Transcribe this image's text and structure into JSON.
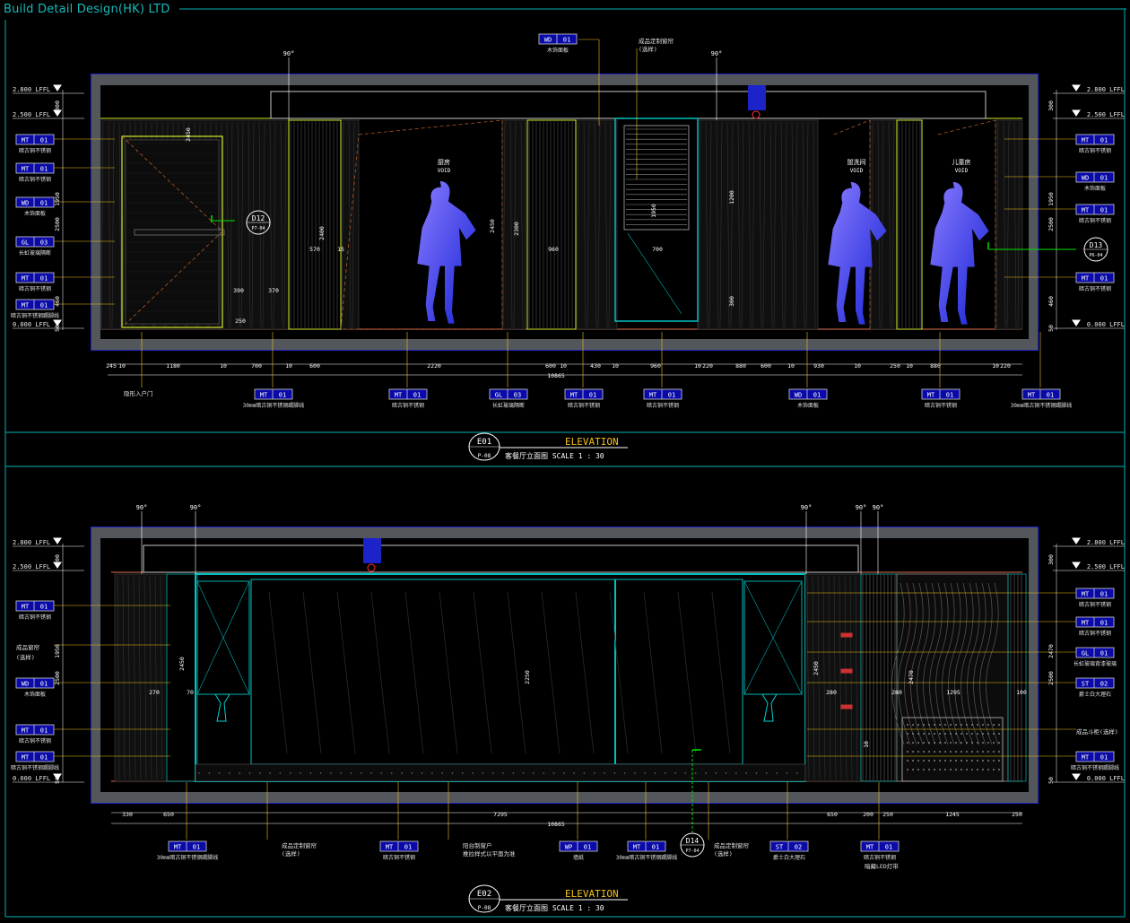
{
  "brand": "Build Detail Design(HK) LTD",
  "colors": {
    "frame": "#00b4b4",
    "wall": "#1c23c8",
    "ceiling_band": "#53575c",
    "leader": "#f1c21b",
    "tag_fill": "#0a0aa8",
    "green": "#00e000",
    "cyan": "#00d0d0",
    "yellow_green": "#d6ea2a"
  },
  "elevation_1": {
    "title": "ELEVATION",
    "drawing_no": "E01",
    "sheet_ref": "P-08",
    "subtitle": "客餐厅立面图 SCALE 1 : 30",
    "left_levels": [
      "2.800 LFFL",
      "2.500 LFFL",
      "0.000 LFFL"
    ],
    "right_levels": [
      "2.800 LFFL",
      "2.500 LFFL",
      "0.000 LFFL"
    ],
    "angles": [
      "90°",
      "90°"
    ],
    "rooms": [
      "厨房",
      "盥洗间",
      "儿童房"
    ],
    "void_label": "VOID",
    "top_tags": [
      {
        "code": "WD",
        "num": "01",
        "label": "木饰面板"
      },
      {
        "code": "",
        "num": "",
        "label": "成品定制窗帘"
      },
      {
        "code": "",
        "num": "",
        "label": "(选样)"
      }
    ],
    "left_tags": [
      {
        "code": "MT",
        "num": "01",
        "label": "暗古铜不锈钢"
      },
      {
        "code": "MT",
        "num": "01",
        "label": "暗古铜不锈钢"
      },
      {
        "code": "WD",
        "num": "01",
        "label": "木饰面板"
      },
      {
        "code": "GL",
        "num": "03",
        "label": "长虹玻璃隔断"
      },
      {
        "code": "MT",
        "num": "01",
        "label": "暗古铜不锈钢"
      },
      {
        "code": "MT",
        "num": "01",
        "label": "暗古铜不锈钢踢脚线"
      }
    ],
    "right_tags": [
      {
        "code": "MT",
        "num": "01",
        "label": "暗古铜不锈钢"
      },
      {
        "code": "WD",
        "num": "01",
        "label": "木饰面板"
      },
      {
        "code": "MT",
        "num": "01",
        "label": "暗古铜不锈钢"
      },
      {
        "code": "MT",
        "num": "01",
        "label": "暗古铜不锈钢"
      }
    ],
    "left_dims": [
      "300",
      "1950",
      "2500",
      "460",
      "50"
    ],
    "right_dims": [
      "300",
      "1950",
      "2500",
      "460",
      "50"
    ],
    "interior_dims": [
      "2400",
      "2450",
      "2300",
      "1950",
      "1200",
      "300",
      "390",
      "370",
      "570",
      "960",
      "700",
      "2450",
      "15",
      "250"
    ],
    "section_markers": [
      {
        "id": "D12",
        "ref": "P7-04"
      },
      {
        "id": "D13",
        "ref": "P6-04"
      }
    ],
    "bottom_dims": [
      "245",
      "10",
      "1180",
      "10",
      "700",
      "10",
      "600",
      "2220",
      "600",
      "10",
      "430",
      "10",
      "960",
      "10",
      "220",
      "880",
      "600",
      "10",
      "930",
      "10",
      "250",
      "10",
      "880",
      "10",
      "220"
    ],
    "total_dim": "10865",
    "bottom_tags": [
      {
        "code": "",
        "num": "",
        "label": "隐形入户门"
      },
      {
        "code": "MT",
        "num": "01",
        "label": "30mm暗古铜不锈钢踢脚线"
      },
      {
        "code": "MT",
        "num": "01",
        "label": "暗古铜不锈钢"
      },
      {
        "code": "GL",
        "num": "03",
        "label": "长虹玻璃隔断"
      },
      {
        "code": "MT",
        "num": "01",
        "label": "暗古铜不锈钢"
      },
      {
        "code": "MT",
        "num": "01",
        "label": "暗古铜不锈钢"
      },
      {
        "code": "WD",
        "num": "01",
        "label": "木饰面板"
      },
      {
        "code": "MT",
        "num": "01",
        "label": "暗古铜不锈钢"
      },
      {
        "code": "MT",
        "num": "01",
        "label": "30mm暗古铜不锈钢踢脚线"
      }
    ]
  },
  "elevation_2": {
    "title": "ELEVATION",
    "drawing_no": "E02",
    "sheet_ref": "P-08",
    "subtitle": "客餐厅立面图 SCALE 1 : 30",
    "left_levels": [
      "2.800 LFFL",
      "2.500 LFFL",
      "0.000 LFFL"
    ],
    "right_levels": [
      "2.800 LFFL",
      "2.500 LFFL",
      "0.000 LFFL"
    ],
    "angles": [
      "90°",
      "90°",
      "90°",
      "90°",
      "90°"
    ],
    "left_tags": [
      {
        "code": "MT",
        "num": "01",
        "label": "暗古铜不锈钢"
      },
      {
        "code": "",
        "num": "",
        "label": "成品窗帘"
      },
      {
        "code": "",
        "num": "",
        "label": "(选样)"
      },
      {
        "code": "WD",
        "num": "01",
        "label": "木饰面板"
      },
      {
        "code": "MT",
        "num": "01",
        "label": "暗古铜不锈钢"
      },
      {
        "code": "MT",
        "num": "01",
        "label": "暗古铜不锈钢踢脚线"
      }
    ],
    "right_tags": [
      {
        "code": "MT",
        "num": "01",
        "label": "暗古铜不锈钢"
      },
      {
        "code": "MT",
        "num": "01",
        "label": "暗古铜不锈钢"
      },
      {
        "code": "GL",
        "num": "01",
        "label": "长虹玻璃背漆玻璃"
      },
      {
        "code": "ST",
        "num": "02",
        "label": "爵士白大理石"
      },
      {
        "code": "",
        "num": "",
        "label": "成品斗柜(选样)"
      },
      {
        "code": "MT",
        "num": "01",
        "label": "暗古铜不锈钢踢脚线"
      }
    ],
    "left_dims": [
      "300",
      "1950",
      "2500",
      "50"
    ],
    "right_dims": [
      "300",
      "2470",
      "2500",
      "50"
    ],
    "interior_dims": [
      "2450",
      "2250",
      "2450",
      "2470",
      "1295",
      "280",
      "100",
      "270",
      "70",
      "280",
      "10"
    ],
    "section_markers": [
      {
        "id": "D14",
        "ref": "P7-04"
      }
    ],
    "bottom_dims": [
      "330",
      "650",
      "7295",
      "650",
      "200",
      "250",
      "1245",
      "250"
    ],
    "total_dim": "10865",
    "bottom_tags": [
      {
        "code": "MT",
        "num": "01",
        "label": "30mm暗古铜不锈钢踢脚线"
      },
      {
        "code": "",
        "num": "",
        "label": "成品定制窗帘"
      },
      {
        "code": "",
        "num": "",
        "label": "(选样)"
      },
      {
        "code": "MT",
        "num": "01",
        "label": "暗古铜不锈钢"
      },
      {
        "code": "",
        "num": "",
        "label": "阳台制窗户"
      },
      {
        "code": "",
        "num": "",
        "label": "推拉样式以平面为准"
      },
      {
        "code": "WP",
        "num": "01",
        "label": "墙纸"
      },
      {
        "code": "MT",
        "num": "01",
        "label": "30mm暗古铜不锈钢踢脚线"
      },
      {
        "code": "",
        "num": "",
        "label": "成品定制窗帘"
      },
      {
        "code": "",
        "num": "",
        "label": "(选样)"
      },
      {
        "code": "ST",
        "num": "02",
        "label": "爵士白大理石"
      },
      {
        "code": "MT",
        "num": "01",
        "label": "暗古铜不锈钢"
      },
      {
        "code": "",
        "num": "",
        "label": "暗藏LED灯带"
      }
    ]
  }
}
